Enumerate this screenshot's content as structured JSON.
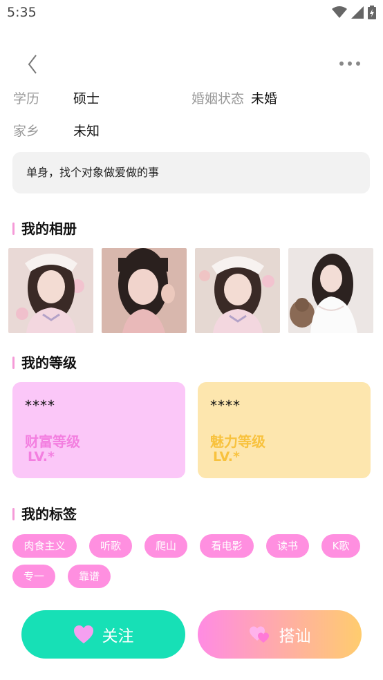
{
  "status_bar": {
    "time": "5:35"
  },
  "profile": {
    "education_label": "学历",
    "education_value": "硕士",
    "marital_label": "婚姻状态",
    "marital_value": "未婚",
    "hometown_label": "家乡",
    "hometown_value": "未知",
    "bio": "单身，找个对象做爱做的事"
  },
  "sections": {
    "album": "我的相册",
    "level": "我的等级",
    "tags": "我的标签"
  },
  "levels": [
    {
      "stars": "****",
      "name": "财富等级",
      "value": "LV.*",
      "bg": "#fbc7f8",
      "color": "#f37fe0"
    },
    {
      "stars": "****",
      "name": "魅力等级",
      "value": "LV.*",
      "bg": "#fde6ae",
      "color": "#f8c23e"
    }
  ],
  "tags": [
    "肉食主义",
    "听歌",
    "爬山",
    "看电影",
    "读书",
    "K歌",
    "专一",
    "靠谱"
  ],
  "actions": {
    "follow_label": "关注",
    "chat_label": "搭讪"
  },
  "colors": {
    "accent_pink": "#ff8fe0",
    "follow_green": "#17e0b6",
    "chat_gradient_start": "#ff8be3",
    "chat_gradient_end": "#ffcc6e"
  }
}
